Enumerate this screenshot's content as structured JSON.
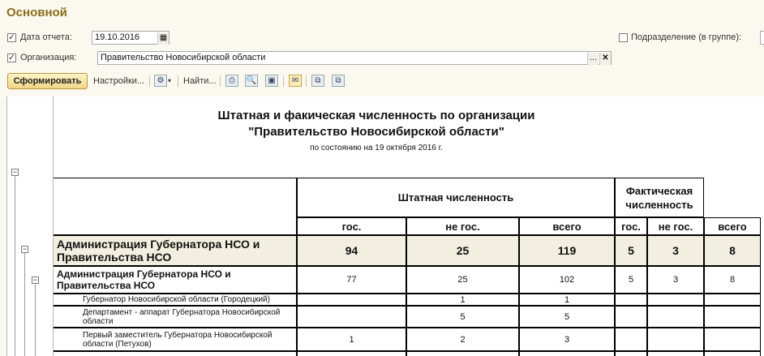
{
  "window": {
    "title": "Основной"
  },
  "filters": {
    "date_label": "Дата отчета:",
    "date_value": "19.10.2016",
    "org_label": "Организация:",
    "org_value": "Правительство Новосибирской области",
    "subdiv_label": "Подразделение (в группе):"
  },
  "toolbar": {
    "generate": "Сформировать",
    "settings": "Настройки...",
    "find": "Найти..."
  },
  "report": {
    "title_line1": "Штатная и факическая численность по организации",
    "title_line2": "\"Правительство Новосибирской области\"",
    "subtitle": "по состоянию на   19 октября 2016 г.",
    "headers": {
      "staff": "Штатная численность",
      "actual": "Фактическая численность",
      "gos": "гос.",
      "ne_gos": "не гос.",
      "total": "всего"
    },
    "rows": [
      {
        "name": "Администрация Губернатора НСО и Правительства НСО",
        "s_gos": "94",
        "s_ne": "25",
        "s_all": "119",
        "f_gos": "5",
        "f_ne": "3",
        "f_all": "8"
      },
      {
        "name": "Администрация Губернатора НСО и Правительства НСО",
        "s_gos": "77",
        "s_ne": "25",
        "s_all": "102",
        "f_gos": "5",
        "f_ne": "3",
        "f_all": "8"
      },
      {
        "name": "Губернатор Новосибирской области (Городецкий)",
        "s_gos": "",
        "s_ne": "1",
        "s_all": "1",
        "f_gos": "",
        "f_ne": "",
        "f_all": ""
      },
      {
        "name": "Департамент - аппарат Губернатора Новосибирской области",
        "s_gos": "",
        "s_ne": "5",
        "s_all": "5",
        "f_gos": "",
        "f_ne": "",
        "f_all": ""
      },
      {
        "name": "Первый заместитель Губернатора Новосибирской области (Петухов)",
        "s_gos": "1",
        "s_ne": "2",
        "s_all": "3",
        "f_gos": "",
        "f_ne": "",
        "f_all": ""
      }
    ]
  }
}
